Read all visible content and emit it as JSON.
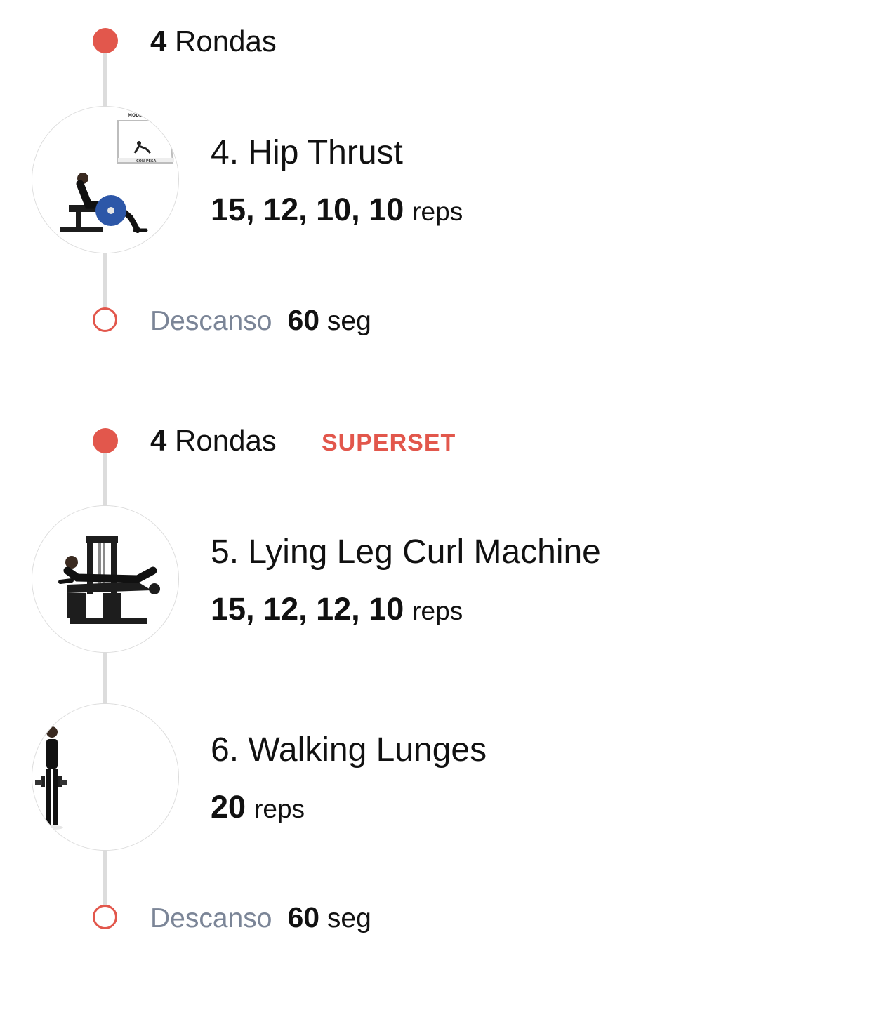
{
  "colors": {
    "accent": "#e2574c",
    "rest_label": "#7b8597",
    "timeline": "#dcdcdc"
  },
  "groups": [
    {
      "rounds_number": "4",
      "rounds_label": "Rondas",
      "badge": "",
      "exercises": [
        {
          "title": "4. Hip Thrust",
          "reps_values": "15, 12, 10, 10",
          "reps_unit": "reps",
          "thumbnail_icon": "hip-thrust-thumbnail",
          "thumbnail_text_top": "MODE",
          "thumbnail_text_bottom": "CON PESA"
        }
      ],
      "rest": {
        "label": "Descanso",
        "value": "60",
        "unit": "seg"
      }
    },
    {
      "rounds_number": "4",
      "rounds_label": "Rondas",
      "badge": "SUPERSET",
      "exercises": [
        {
          "title": "5. Lying Leg Curl Machine",
          "reps_values": "15, 12, 12, 10",
          "reps_unit": "reps",
          "thumbnail_icon": "leg-curl-machine-thumbnail"
        },
        {
          "title": "6. Walking Lunges",
          "reps_values": "20",
          "reps_unit": "reps",
          "thumbnail_icon": "walking-lunges-thumbnail"
        }
      ],
      "rest": {
        "label": "Descanso",
        "value": "60",
        "unit": "seg"
      }
    }
  ]
}
